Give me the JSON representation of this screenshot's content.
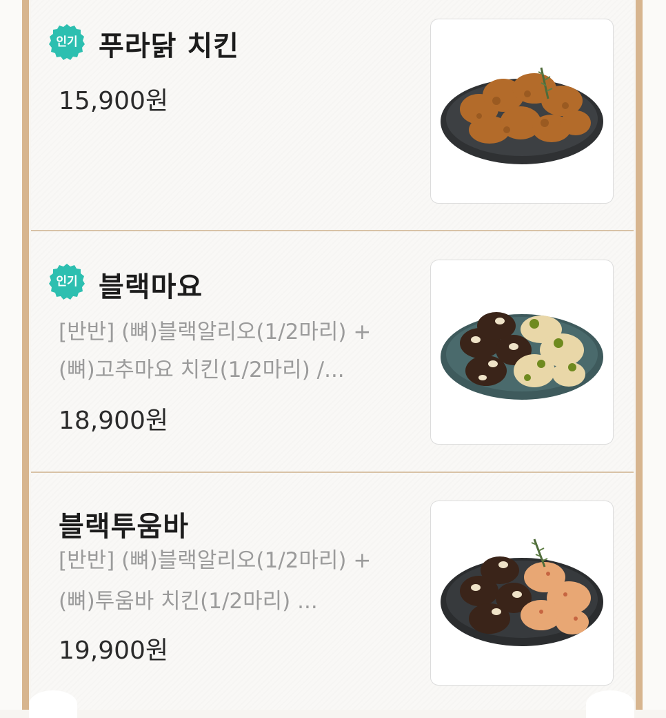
{
  "colors": {
    "badge": "#2dbfb0",
    "frame": "#d7b58f",
    "divider": "#d8c2a6",
    "title": "#1c1c1c",
    "description": "#9b9b9b",
    "price": "#2a2a2a"
  },
  "menu": {
    "items": [
      {
        "badge": "인기",
        "name": "푸라닭 치킨",
        "description": [
          "",
          ""
        ],
        "price": "15,900원",
        "image_icon": "fried-chicken-plate"
      },
      {
        "badge": "인기",
        "name": "블랙마요",
        "description": [
          "[반반] (뼈)블랙알리오(1/2마리) +",
          "(뼈)고추마요 치킨(1/2마리) /..."
        ],
        "price": "18,900원",
        "image_icon": "black-mayo-chicken-plate"
      },
      {
        "badge": "",
        "name": "블랙투움바",
        "description": [
          "[반반] (뼈)블랙알리오(1/2마리) +",
          "(뼈)투움바 치킨(1/2마리) ..."
        ],
        "price": "19,900원",
        "image_icon": "black-tuumba-chicken-plate"
      }
    ]
  }
}
